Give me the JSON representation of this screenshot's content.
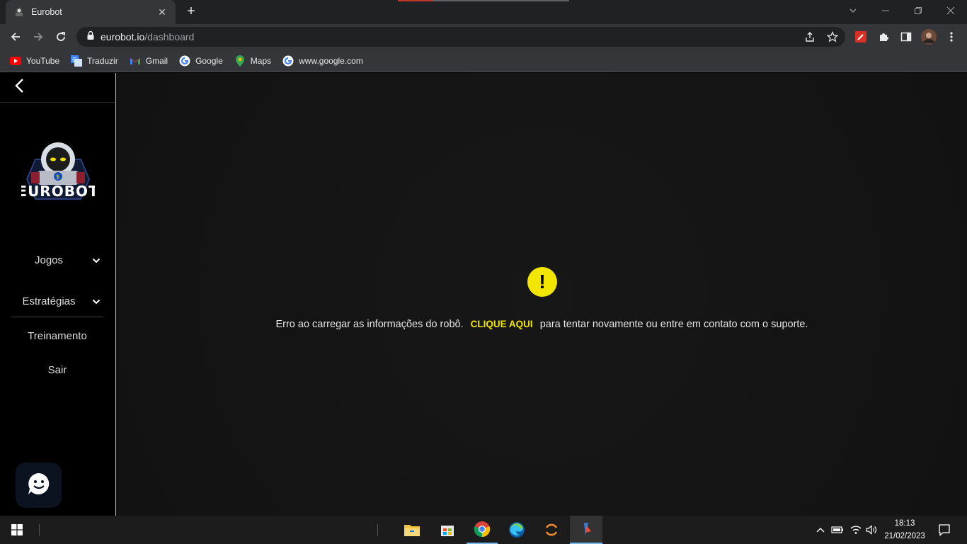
{
  "browser": {
    "tab_title": "Eurobot",
    "tab_close": "✕",
    "new_tab": "+",
    "url_host": "eurobot.io",
    "url_path": "/dashboard"
  },
  "bookmarks": [
    {
      "label": "YouTube",
      "icon": "youtube-icon"
    },
    {
      "label": "Traduzir",
      "icon": "translate-icon"
    },
    {
      "label": "Gmail",
      "icon": "gmail-icon"
    },
    {
      "label": "Google",
      "icon": "google-icon"
    },
    {
      "label": "Maps",
      "icon": "maps-icon"
    },
    {
      "label": "www.google.com",
      "icon": "google-icon"
    }
  ],
  "sidebar": {
    "logo_text": "EUROBOT",
    "items": [
      {
        "label": "Jogos"
      },
      {
        "label": "Estratégias"
      },
      {
        "label": "Treinamento"
      },
      {
        "label": "Sair"
      }
    ]
  },
  "main": {
    "error_icon": "!",
    "error_before": "Erro ao carregar as informações do robô.",
    "error_link": "CLIQUE AQUI",
    "error_after": "para tentar novamente ou entre em contato com o suporte."
  },
  "taskbar": {
    "time": "18:13",
    "date": "21/02/2023"
  },
  "colors": {
    "accent": "#f2e600",
    "sidebar_border": "#e8c63b",
    "chrome_dark": "#202124",
    "chrome_mid": "#35363a"
  }
}
